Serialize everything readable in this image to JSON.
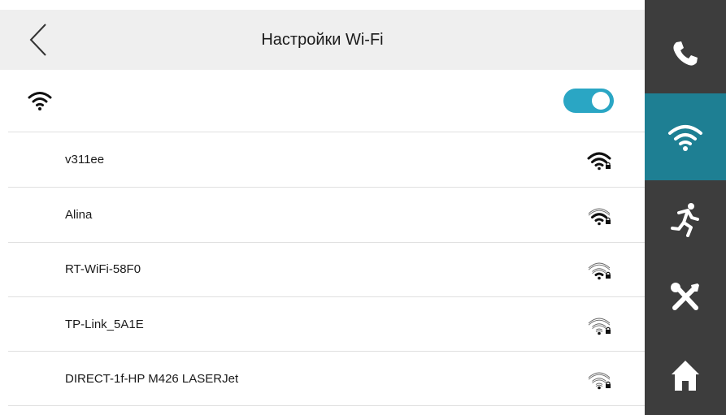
{
  "header": {
    "title": "Настройки Wi-Fi",
    "back_icon": "chevron-left-icon"
  },
  "wifi_toggle": {
    "enabled": true,
    "color": "#2aa6c4"
  },
  "networks": [
    {
      "ssid": "v311ee",
      "signal_bars": 4,
      "secured": true
    },
    {
      "ssid": "Alina",
      "signal_bars": 3,
      "secured": true
    },
    {
      "ssid": "RT-WiFi-58F0",
      "signal_bars": 2,
      "secured": true
    },
    {
      "ssid": "TP-Link_5A1E",
      "signal_bars": 1,
      "secured": true
    },
    {
      "ssid": "DIRECT-1f-HP M426 LASERJet",
      "signal_bars": 1,
      "secured": true
    }
  ],
  "sidebar": {
    "background": "#3d3d3d",
    "active_color": "#1e7f93",
    "items": [
      {
        "icon": "phone-icon",
        "active": false
      },
      {
        "icon": "wifi-icon",
        "active": true
      },
      {
        "icon": "motion-detection-icon",
        "active": false
      },
      {
        "icon": "tools-icon",
        "active": false
      },
      {
        "icon": "home-icon",
        "active": false
      }
    ]
  }
}
